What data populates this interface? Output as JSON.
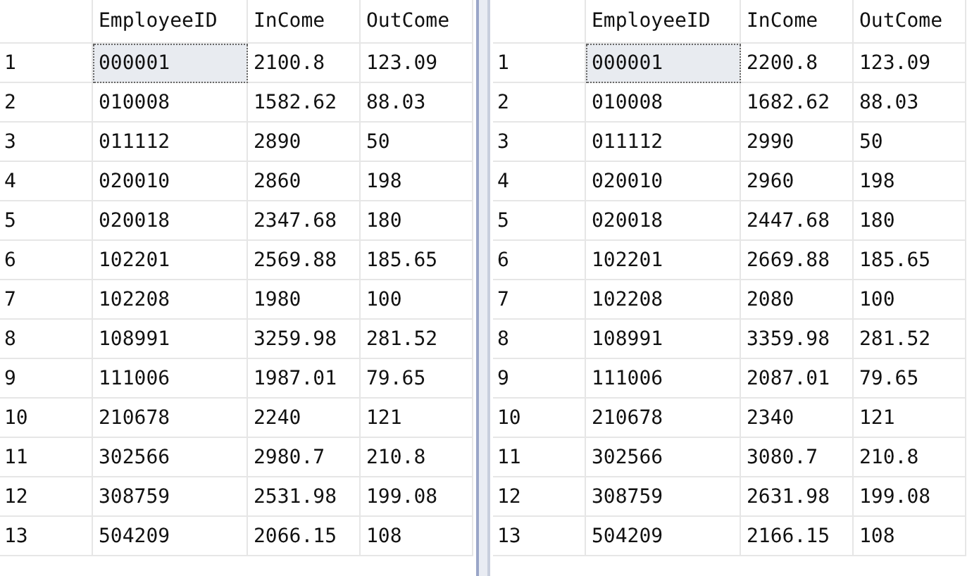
{
  "grids": [
    {
      "columns": [
        "EmployeeID",
        "InCome",
        "OutCome"
      ],
      "rows": [
        {
          "number": "1",
          "cells": [
            {
              "text": "000001",
              "selected": true
            },
            {
              "text": "2100.8",
              "selected": false
            },
            {
              "text": "123.09",
              "selected": false
            }
          ]
        },
        {
          "number": "2",
          "cells": [
            {
              "text": "010008",
              "selected": false
            },
            {
              "text": "1582.62",
              "selected": false
            },
            {
              "text": "88.03",
              "selected": false
            }
          ]
        },
        {
          "number": "3",
          "cells": [
            {
              "text": "011112",
              "selected": false
            },
            {
              "text": "2890",
              "selected": false
            },
            {
              "text": "50",
              "selected": false
            }
          ]
        },
        {
          "number": "4",
          "cells": [
            {
              "text": "020010",
              "selected": false
            },
            {
              "text": "2860",
              "selected": false
            },
            {
              "text": "198",
              "selected": false
            }
          ]
        },
        {
          "number": "5",
          "cells": [
            {
              "text": "020018",
              "selected": false
            },
            {
              "text": "2347.68",
              "selected": false
            },
            {
              "text": "180",
              "selected": false
            }
          ]
        },
        {
          "number": "6",
          "cells": [
            {
              "text": "102201",
              "selected": false
            },
            {
              "text": "2569.88",
              "selected": false
            },
            {
              "text": "185.65",
              "selected": false
            }
          ]
        },
        {
          "number": "7",
          "cells": [
            {
              "text": "102208",
              "selected": false
            },
            {
              "text": "1980",
              "selected": false
            },
            {
              "text": "100",
              "selected": false
            }
          ]
        },
        {
          "number": "8",
          "cells": [
            {
              "text": "108991",
              "selected": false
            },
            {
              "text": "3259.98",
              "selected": false
            },
            {
              "text": "281.52",
              "selected": false
            }
          ]
        },
        {
          "number": "9",
          "cells": [
            {
              "text": "111006",
              "selected": false
            },
            {
              "text": "1987.01",
              "selected": false
            },
            {
              "text": "79.65",
              "selected": false
            }
          ]
        },
        {
          "number": "10",
          "cells": [
            {
              "text": "210678",
              "selected": false
            },
            {
              "text": "2240",
              "selected": false
            },
            {
              "text": "121",
              "selected": false
            }
          ]
        },
        {
          "number": "11",
          "cells": [
            {
              "text": "302566",
              "selected": false
            },
            {
              "text": "2980.7",
              "selected": false
            },
            {
              "text": "210.8",
              "selected": false
            }
          ]
        },
        {
          "number": "12",
          "cells": [
            {
              "text": "308759",
              "selected": false
            },
            {
              "text": "2531.98",
              "selected": false
            },
            {
              "text": "199.08",
              "selected": false
            }
          ]
        },
        {
          "number": "13",
          "cells": [
            {
              "text": "504209",
              "selected": false
            },
            {
              "text": "2066.15",
              "selected": false
            },
            {
              "text": "108",
              "selected": false
            }
          ]
        }
      ]
    },
    {
      "columns": [
        "EmployeeID",
        "InCome",
        "OutCome"
      ],
      "rows": [
        {
          "number": "1",
          "cells": [
            {
              "text": "000001",
              "selected": true
            },
            {
              "text": "2200.8",
              "selected": false
            },
            {
              "text": "123.09",
              "selected": false
            }
          ]
        },
        {
          "number": "2",
          "cells": [
            {
              "text": "010008",
              "selected": false
            },
            {
              "text": "1682.62",
              "selected": false
            },
            {
              "text": "88.03",
              "selected": false
            }
          ]
        },
        {
          "number": "3",
          "cells": [
            {
              "text": "011112",
              "selected": false
            },
            {
              "text": "2990",
              "selected": false
            },
            {
              "text": "50",
              "selected": false
            }
          ]
        },
        {
          "number": "4",
          "cells": [
            {
              "text": "020010",
              "selected": false
            },
            {
              "text": "2960",
              "selected": false
            },
            {
              "text": "198",
              "selected": false
            }
          ]
        },
        {
          "number": "5",
          "cells": [
            {
              "text": "020018",
              "selected": false
            },
            {
              "text": "2447.68",
              "selected": false
            },
            {
              "text": "180",
              "selected": false
            }
          ]
        },
        {
          "number": "6",
          "cells": [
            {
              "text": "102201",
              "selected": false
            },
            {
              "text": "2669.88",
              "selected": false
            },
            {
              "text": "185.65",
              "selected": false
            }
          ]
        },
        {
          "number": "7",
          "cells": [
            {
              "text": "102208",
              "selected": false
            },
            {
              "text": "2080",
              "selected": false
            },
            {
              "text": "100",
              "selected": false
            }
          ]
        },
        {
          "number": "8",
          "cells": [
            {
              "text": "108991",
              "selected": false
            },
            {
              "text": "3359.98",
              "selected": false
            },
            {
              "text": "281.52",
              "selected": false
            }
          ]
        },
        {
          "number": "9",
          "cells": [
            {
              "text": "111006",
              "selected": false
            },
            {
              "text": "2087.01",
              "selected": false
            },
            {
              "text": "79.65",
              "selected": false
            }
          ]
        },
        {
          "number": "10",
          "cells": [
            {
              "text": "210678",
              "selected": false
            },
            {
              "text": "2340",
              "selected": false
            },
            {
              "text": "121",
              "selected": false
            }
          ]
        },
        {
          "number": "11",
          "cells": [
            {
              "text": "302566",
              "selected": false
            },
            {
              "text": "3080.7",
              "selected": false
            },
            {
              "text": "210.8",
              "selected": false
            }
          ]
        },
        {
          "number": "12",
          "cells": [
            {
              "text": "308759",
              "selected": false
            },
            {
              "text": "2631.98",
              "selected": false
            },
            {
              "text": "199.08",
              "selected": false
            }
          ]
        },
        {
          "number": "13",
          "cells": [
            {
              "text": "504209",
              "selected": false
            },
            {
              "text": "2166.15",
              "selected": false
            },
            {
              "text": "108",
              "selected": false
            }
          ]
        }
      ]
    }
  ]
}
